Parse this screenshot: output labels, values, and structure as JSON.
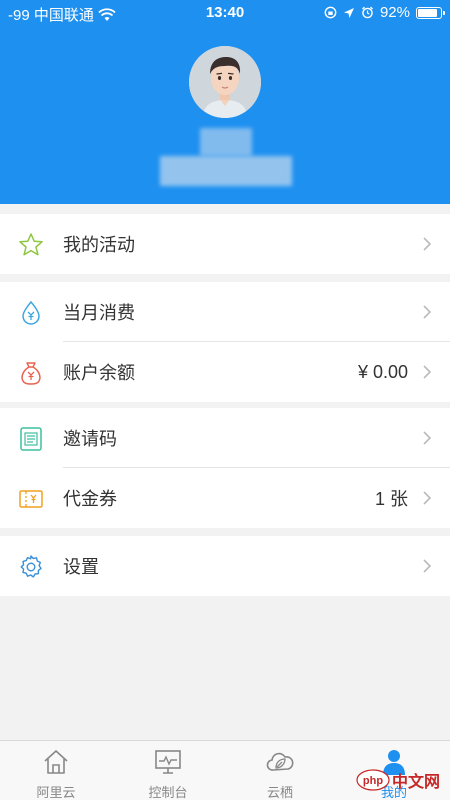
{
  "status_bar": {
    "carrier": "-99 中国联通",
    "time": "13:40",
    "battery": "92%",
    "battery_level": 0.92
  },
  "menu": {
    "activities": {
      "label": "我的活动",
      "icon": "star-icon"
    },
    "monthly_spend": {
      "label": "当月消费",
      "icon": "drop-yen-icon"
    },
    "balance": {
      "label": "账户余额",
      "value": "¥ 0.00",
      "icon": "money-bag-icon"
    },
    "invite_code": {
      "label": "邀请码",
      "icon": "document-icon"
    },
    "voucher": {
      "label": "代金券",
      "value": "1 张",
      "icon": "ticket-icon"
    },
    "settings": {
      "label": "设置",
      "icon": "gear-icon"
    }
  },
  "tabs": [
    {
      "label": "阿里云",
      "icon": "home-icon"
    },
    {
      "label": "控制台",
      "icon": "monitor-icon"
    },
    {
      "label": "云栖",
      "icon": "cloud-leaf-icon"
    },
    {
      "label": "我的",
      "icon": "person-icon"
    }
  ],
  "watermark": {
    "text": "中文网",
    "logo": "php"
  },
  "colors": {
    "primary": "#1e90f0",
    "background": "#f2f2f2",
    "text": "#333333"
  }
}
